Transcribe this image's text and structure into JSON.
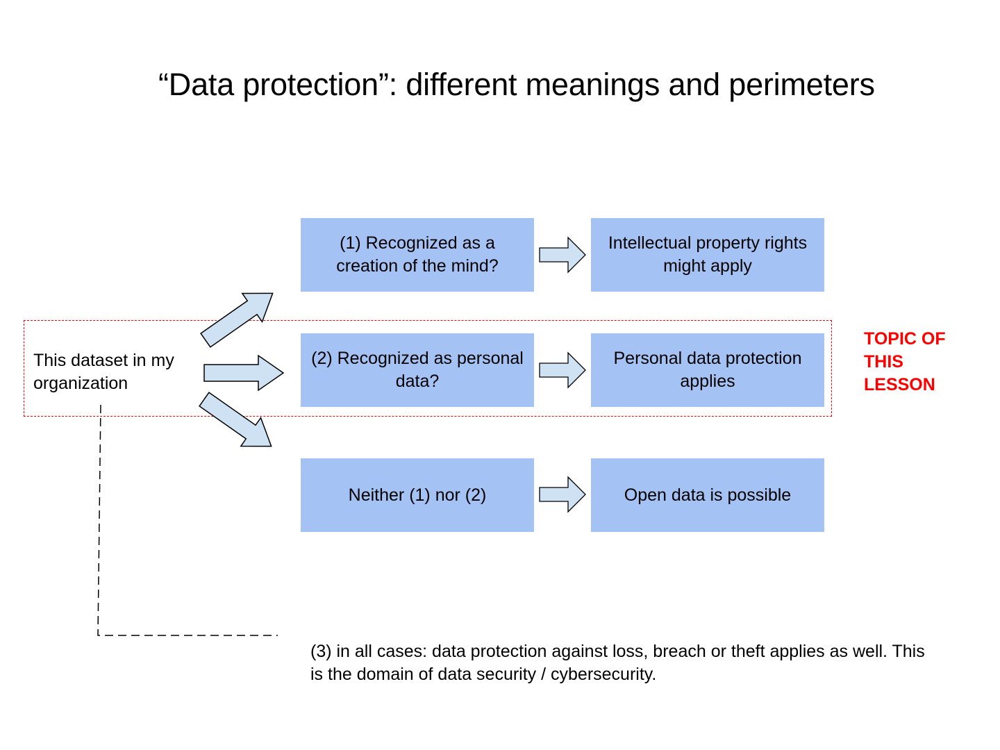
{
  "title": "“Data protection”: different meanings and perimeters",
  "source": {
    "line1": "This dataset in my",
    "line2": "organization"
  },
  "rows": [
    {
      "question": "(1) Recognized as a creation of the mind?",
      "outcome": "Intellectual property rights might apply"
    },
    {
      "question": "(2) Recognized as personal data?",
      "outcome": "Personal data protection applies"
    },
    {
      "question": "Neither (1) nor (2)",
      "outcome": "Open data is possible"
    }
  ],
  "topic_label": {
    "line1": "TOPIC OF",
    "line2": "THIS",
    "line3": "LESSON"
  },
  "footnote": "(3) in all cases: data protection against loss, breach or theft applies as well. This is the domain of data security / cybersecurity.",
  "colors": {
    "box_fill": "#a4c2f4",
    "arrow_fill": "#cfe2f3",
    "highlight": "#ff0000"
  }
}
